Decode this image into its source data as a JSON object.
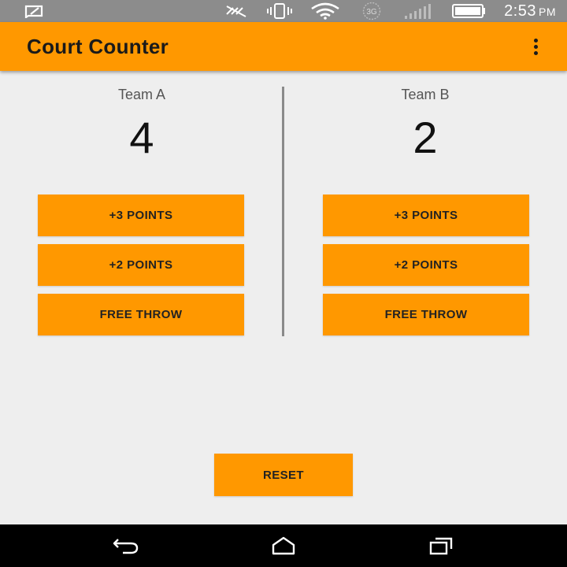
{
  "status_bar": {
    "time": "2:53",
    "ampm": "PM",
    "network": "3G",
    "icons": [
      "message-icon",
      "data-sync-off-icon",
      "vibrate-icon",
      "wifi-icon",
      "network-3g-icon",
      "signal-icon",
      "battery-icon"
    ]
  },
  "app_bar": {
    "title": "Court Counter",
    "menu_icon": "overflow-menu-icon"
  },
  "team_a": {
    "name": "Team A",
    "score": "4",
    "buttons": {
      "three": "+3 POINTS",
      "two": "+2 POINTS",
      "free_throw": "FREE THROW"
    }
  },
  "team_b": {
    "name": "Team B",
    "score": "2",
    "buttons": {
      "three": "+3 POINTS",
      "two": "+2 POINTS",
      "free_throw": "FREE THROW"
    }
  },
  "reset_label": "RESET",
  "nav_bar": {
    "icons": [
      "back-icon",
      "home-icon",
      "recents-icon"
    ]
  },
  "colors": {
    "accent": "#ff9800",
    "background": "#eeeeee",
    "status_bar": "#8c8c8c",
    "nav_bar": "#000000"
  }
}
